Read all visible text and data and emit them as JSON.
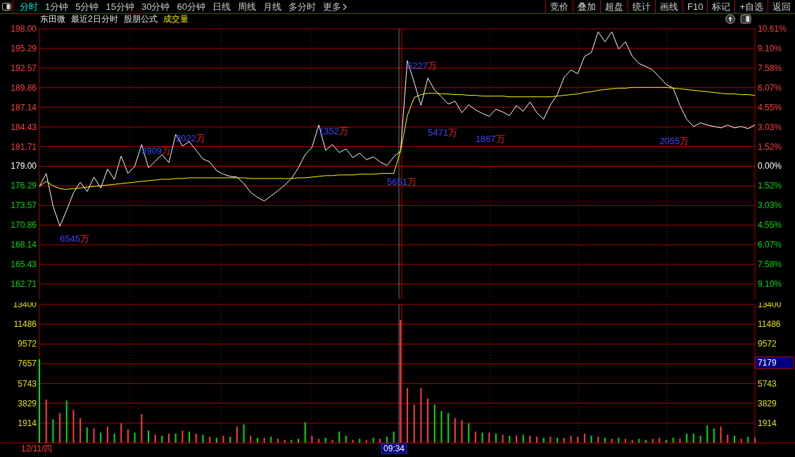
{
  "toolbar": {
    "tabs": [
      {
        "label": "分时",
        "selected": true
      },
      {
        "label": "1分钟",
        "selected": false
      },
      {
        "label": "5分钟",
        "selected": false
      },
      {
        "label": "15分钟",
        "selected": false
      },
      {
        "label": "30分钟",
        "selected": false
      },
      {
        "label": "60分钟",
        "selected": false
      },
      {
        "label": "日线",
        "selected": false
      },
      {
        "label": "周线",
        "selected": false
      },
      {
        "label": "月线",
        "selected": false
      },
      {
        "label": "多分时",
        "selected": false
      },
      {
        "label": "更多",
        "selected": false
      }
    ],
    "buttons": [
      "竞价",
      "叠加",
      "超盘",
      "统计",
      "画线",
      "F10",
      "标记",
      "+自选",
      "返回"
    ]
  },
  "header": {
    "stock": "东田微",
    "mode": "最近2日分时",
    "formula": "股朋公式",
    "indicator": "成交量"
  },
  "price_chart": {
    "percent_labels": [
      "10.61%",
      "9.10%",
      "7.58%",
      "6.07%",
      "4.55%",
      "3.03%",
      "1.52%",
      "0.00%",
      "1.52%",
      "3.03%",
      "4.55%",
      "6.07%",
      "7.58%",
      "9.10%"
    ],
    "turnover_labels": [
      {
        "text": "6545万"
      },
      {
        "text": "2909万"
      },
      {
        "text": "3022万"
      },
      {
        "text": "1352万"
      },
      {
        "text": "5651万"
      },
      {
        "text": "5227万"
      },
      {
        "text": "5471万"
      },
      {
        "text": "1867万"
      },
      {
        "text": "2055万"
      }
    ],
    "chart_data": {
      "type": "line",
      "grid": true,
      "ylim": [
        160.67,
        198.0
      ],
      "yticks": [
        {
          "value": 198.0,
          "label": "198.00"
        },
        {
          "value": 195.29,
          "label": "195.29"
        },
        {
          "value": 192.57,
          "label": "192.57"
        },
        {
          "value": 189.86,
          "label": "189.86"
        },
        {
          "value": 187.14,
          "label": "187.14"
        },
        {
          "value": 184.43,
          "label": "184.43"
        },
        {
          "value": 181.71,
          "label": "181.71"
        },
        {
          "value": 179.0,
          "label": "179.00"
        },
        {
          "value": 176.29,
          "label": "176.29"
        },
        {
          "value": 173.57,
          "label": "173.57"
        },
        {
          "value": 170.86,
          "label": "170.86"
        },
        {
          "value": 168.14,
          "label": "168.14"
        },
        {
          "value": 165.43,
          "label": "165.43"
        },
        {
          "value": 162.71,
          "label": "162.71"
        }
      ],
      "series": [
        {
          "color": "#ffffff",
          "values": [
            176.2,
            178.0,
            173.5,
            170.7,
            172.9,
            175.3,
            176.8,
            175.5,
            177.5,
            176.0,
            178.6,
            177.2,
            180.4,
            178.0,
            179.0,
            182.0,
            178.8,
            179.7,
            180.6,
            179.5,
            183.4,
            181.8,
            182.4,
            181.2,
            180.0,
            179.6,
            178.4,
            177.9,
            177.6,
            177.5,
            176.6,
            175.4,
            174.7,
            174.2,
            174.9,
            175.6,
            176.4,
            177.3,
            178.8,
            180.6,
            181.6,
            184.7,
            181.2,
            182.0,
            180.9,
            181.4,
            180.2,
            180.8,
            179.9,
            180.3,
            179.6,
            179.1,
            180.3,
            181.1,
            193.6,
            190.6,
            187.4,
            191.2,
            189.5,
            188.6,
            187.6,
            188.0,
            186.4,
            187.5,
            186.8,
            186.3,
            185.9,
            186.9,
            186.5,
            186.0,
            187.4,
            186.6,
            187.9,
            186.4,
            185.5,
            187.5,
            188.9,
            191.3,
            192.3,
            191.8,
            194.2,
            194.7,
            197.6,
            196.2,
            197.6,
            195.2,
            196.2,
            194.2,
            193.2,
            192.8,
            192.3,
            191.3,
            190.3,
            189.8,
            187.4,
            185.5,
            184.5,
            185.0,
            184.7,
            184.5,
            184.3,
            184.7,
            184.3,
            184.5,
            184.2,
            184.7
          ]
        },
        {
          "color": "#ffff00",
          "values": [
            176.2,
            176.9,
            176.3,
            175.9,
            175.8,
            175.9,
            176.0,
            176.1,
            176.2,
            176.3,
            176.4,
            176.5,
            176.6,
            176.7,
            176.8,
            176.9,
            177.0,
            177.1,
            177.2,
            177.2,
            177.3,
            177.3,
            177.4,
            177.4,
            177.4,
            177.4,
            177.4,
            177.4,
            177.4,
            177.4,
            177.4,
            177.3,
            177.3,
            177.3,
            177.3,
            177.3,
            177.3,
            177.3,
            177.4,
            177.4,
            177.5,
            177.6,
            177.7,
            177.7,
            177.8,
            177.8,
            177.8,
            177.9,
            177.9,
            177.9,
            178.0,
            178.0,
            178.0,
            181.1,
            186.0,
            188.5,
            188.9,
            189.1,
            189.1,
            189.0,
            189.0,
            188.9,
            188.9,
            188.8,
            188.8,
            188.7,
            188.7,
            188.7,
            188.7,
            188.6,
            188.6,
            188.6,
            188.6,
            188.6,
            188.6,
            188.6,
            188.7,
            188.8,
            188.9,
            189.0,
            189.2,
            189.3,
            189.5,
            189.6,
            189.7,
            189.8,
            189.8,
            189.9,
            189.9,
            189.9,
            189.9,
            189.9,
            189.9,
            189.8,
            189.7,
            189.6,
            189.5,
            189.4,
            189.3,
            189.2,
            189.1,
            189.0,
            189.0,
            188.9,
            188.9,
            188.8
          ]
        }
      ]
    }
  },
  "volume_chart": {
    "chart_data": {
      "type": "bar",
      "stacked": true,
      "grid": true,
      "ylim": [
        0,
        13400
      ],
      "yticks": [
        {
          "value": 13400,
          "label": "13400"
        },
        {
          "value": 11486,
          "label": "11486"
        },
        {
          "value": 9572,
          "label": "9572"
        },
        {
          "value": 7657,
          "label": "7657"
        },
        {
          "value": 5743,
          "label": "5743"
        },
        {
          "value": 3829,
          "label": "3829"
        },
        {
          "value": 1914,
          "label": "1914"
        }
      ],
      "series": [
        {
          "color": "#ff3c3c",
          "values": [
            null,
            4200,
            null,
            2900,
            null,
            3200,
            2400,
            null,
            1400,
            null,
            1600,
            null,
            1900,
            1300,
            null,
            2800,
            null,
            800,
            null,
            900,
            null,
            1200,
            null,
            900,
            null,
            600,
            null,
            700,
            null,
            1600,
            null,
            700,
            null,
            500,
            null,
            400,
            300,
            null,
            null,
            null,
            700,
            400,
            null,
            300,
            null,
            null,
            300,
            null,
            300,
            null,
            400,
            null,
            null,
            11900,
            5300,
            3700,
            5300,
            4300,
            null,
            null,
            null,
            2400,
            2200,
            null,
            1100,
            null,
            1000,
            null,
            800,
            null,
            700,
            null,
            700,
            600,
            null,
            600,
            null,
            500,
            700,
            600,
            900,
            null,
            600,
            null,
            400,
            null,
            400,
            300,
            null,
            null,
            400,
            500,
            null,
            null,
            400,
            null,
            null,
            null,
            null,
            null,
            1600,
            800,
            null,
            400,
            null,
            500
          ]
        },
        {
          "color": "#00e000",
          "values": [
            8100,
            null,
            2300,
            null,
            4100,
            null,
            null,
            1500,
            null,
            1000,
            null,
            900,
            null,
            null,
            1000,
            null,
            1200,
            null,
            700,
            null,
            900,
            null,
            1100,
            null,
            800,
            null,
            500,
            null,
            600,
            null,
            1800,
            null,
            500,
            null,
            600,
            null,
            null,
            300,
            400,
            2000,
            null,
            null,
            500,
            null,
            1100,
            700,
            null,
            400,
            null,
            500,
            null,
            600,
            1100,
            null,
            null,
            null,
            null,
            null,
            3700,
            3100,
            2900,
            null,
            null,
            1900,
            null,
            1000,
            null,
            900,
            null,
            700,
            null,
            800,
            null,
            null,
            500,
            null,
            500,
            null,
            null,
            null,
            null,
            700,
            null,
            500,
            null,
            500,
            null,
            null,
            400,
            300,
            null,
            null,
            300,
            500,
            null,
            900,
            900,
            700,
            1700,
            1400,
            null,
            null,
            700,
            null,
            600,
            null
          ]
        }
      ]
    }
  },
  "cursor": {
    "date": "12/11/四",
    "time": "09:34",
    "value": "7179"
  }
}
